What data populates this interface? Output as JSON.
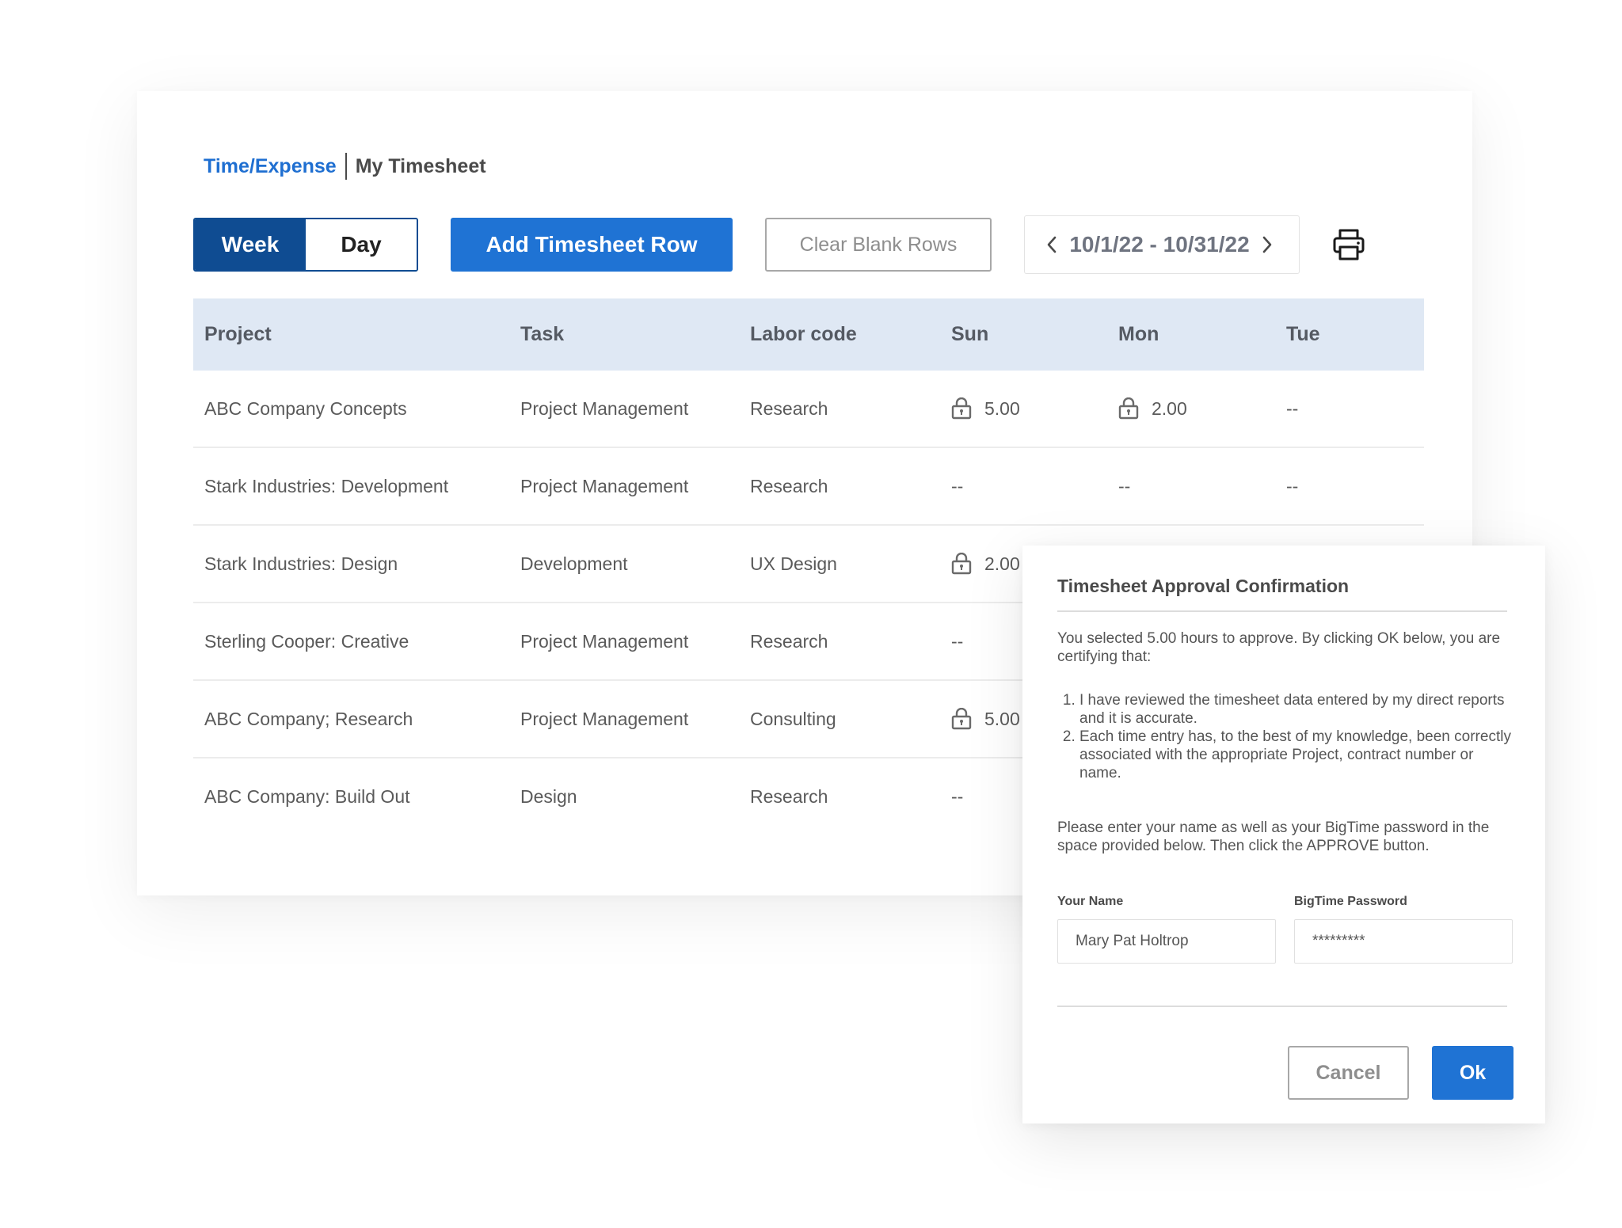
{
  "breadcrumb": {
    "section": "Time/Expense",
    "page": "My Timesheet"
  },
  "view_toggle": {
    "week_label": "Week",
    "day_label": "Day",
    "selected": "Week"
  },
  "toolbar": {
    "add_row_label": "Add Timesheet Row",
    "clear_blank_label": "Clear Blank Rows",
    "date_range": "10/1/22 - 10/31/22",
    "print_icon": "printer-icon",
    "prev_icon": "chevron-left-icon",
    "next_icon": "chevron-right-icon"
  },
  "table": {
    "columns": [
      "Project",
      "Task",
      "Labor code",
      "Sun",
      "Mon",
      "Tue"
    ],
    "rows": [
      {
        "project": "ABC Company Concepts",
        "task": "Project Management",
        "labor": "Research",
        "sun": "5.00",
        "mon": "2.00",
        "tue": "--"
      },
      {
        "project": "Stark Industries: Development",
        "task": "Project Management",
        "labor": "Research",
        "sun": "--",
        "mon": "--",
        "tue": "--"
      },
      {
        "project": "Stark Industries: Design",
        "task": "Development",
        "labor": "UX Design",
        "sun": "2.00",
        "mon": "",
        "tue": ""
      },
      {
        "project": "Sterling Cooper: Creative",
        "task": "Project Management",
        "labor": "Research",
        "sun": "--",
        "mon": "",
        "tue": ""
      },
      {
        "project": "ABC Company; Research",
        "task": "Project Management",
        "labor": "Consulting",
        "sun": "5.00",
        "mon": "",
        "tue": ""
      },
      {
        "project": "ABC Company:  Build Out",
        "task": "Design",
        "labor": "Research",
        "sun": "--",
        "mon": "",
        "tue": ""
      }
    ],
    "lock_icon": "lock-icon"
  },
  "modal": {
    "title": "Timesheet Approval Confirmation",
    "intro": "You selected 5.00 hours to approve. By clicking OK below, you are certifying that:",
    "items": [
      "I have reviewed the timesheet data entered by my direct reports and it is accurate.",
      "Each time entry has, to the best of my knowledge, been correctly associated with the appropriate Project, contract number or name."
    ],
    "instruction": "Please enter your name as well as your BigTime password in the space provided below. Then click the APPROVE button.",
    "name_label": "Your Name",
    "name_value": "Mary Pat Holtrop",
    "password_label": "BigTime Password",
    "password_value": "*********",
    "cancel_label": "Cancel",
    "ok_label": "Ok"
  },
  "colors": {
    "brand_blue": "#1f73d4",
    "navy": "#0f4c92",
    "header_bg": "#dfe8f4",
    "link_blue": "#1f6fd1"
  }
}
